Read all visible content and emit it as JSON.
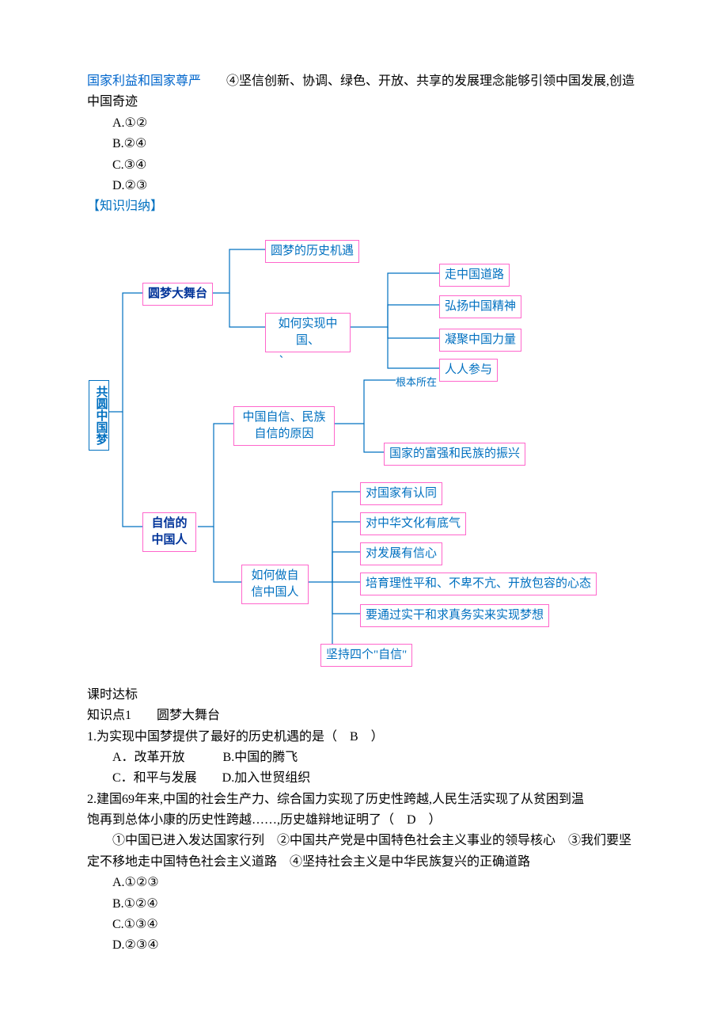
{
  "top": {
    "frag1": "国家利益和国家尊严",
    "frag2": "④坚信创新、协调、绿色、开放、共享的发展理念能够引领中国发展,创造中国奇迹",
    "optA": "A.①②",
    "optB": "B.②④",
    "optC": "C.③④",
    "optD": "D.②③",
    "zsgl": "【知识归纳】"
  },
  "diagram": {
    "root": "共圆中国梦",
    "ymdwt": "圆梦大舞台",
    "zxzgr": "自信的中国人",
    "ymls": "圆梦的历史机遇",
    "rhsx": "如何实现中国、",
    "zzgdl": "走中国道路",
    "hyzgjs": "弘扬中国精神",
    "njzgll": "凝聚中国力量",
    "rrcy": "人人参与",
    "zgzx": "中国自信、民族自信的原因",
    "gbsz": "根本所在",
    "gjfq": "国家的富强和民族的振兴",
    "rhzzx": "如何做自信中国人",
    "dgjrt": "对国家有认同",
    "dzhwh": "对中华文化有底气",
    "dfzxs": "对发展有信心",
    "pylx": "培育理性平和、不卑不亢、开放包容的心态",
    "ysgh": "要通过实干和求真务实来实现梦想",
    "jcsi": "坚持四个\"自信\""
  },
  "q1": {
    "header": "课时达标",
    "kp1": "知识点1　　圆梦大舞台",
    "stem": "1.为实现中国梦提供了最好的历史机遇的是（　B　）",
    "a": "A．改革开放　　　B.中国的腾飞",
    "c": "C．和平与发展　　D.加入世贸组织"
  },
  "q2": {
    "stem1": "2.建国69年来,中国的社会生产力、综合国力实现了历史性跨越,人民生活实现了从贫困到温",
    "stem2": "饱再到总体小康的历史性跨越……,历史雄辩地证明了（　D　）",
    "items": "①中国已进入发达国家行列　②中国共产党是中国特色社会主义事业的领导核心　③我们要坚定不移地走中国特色社会主义道路　④坚持社会主义是中华民族复兴的正确道路",
    "optA": "A.①②③",
    "optB": "B.①②④",
    "optC": "C.①③④",
    "optD": "D.②③④"
  }
}
